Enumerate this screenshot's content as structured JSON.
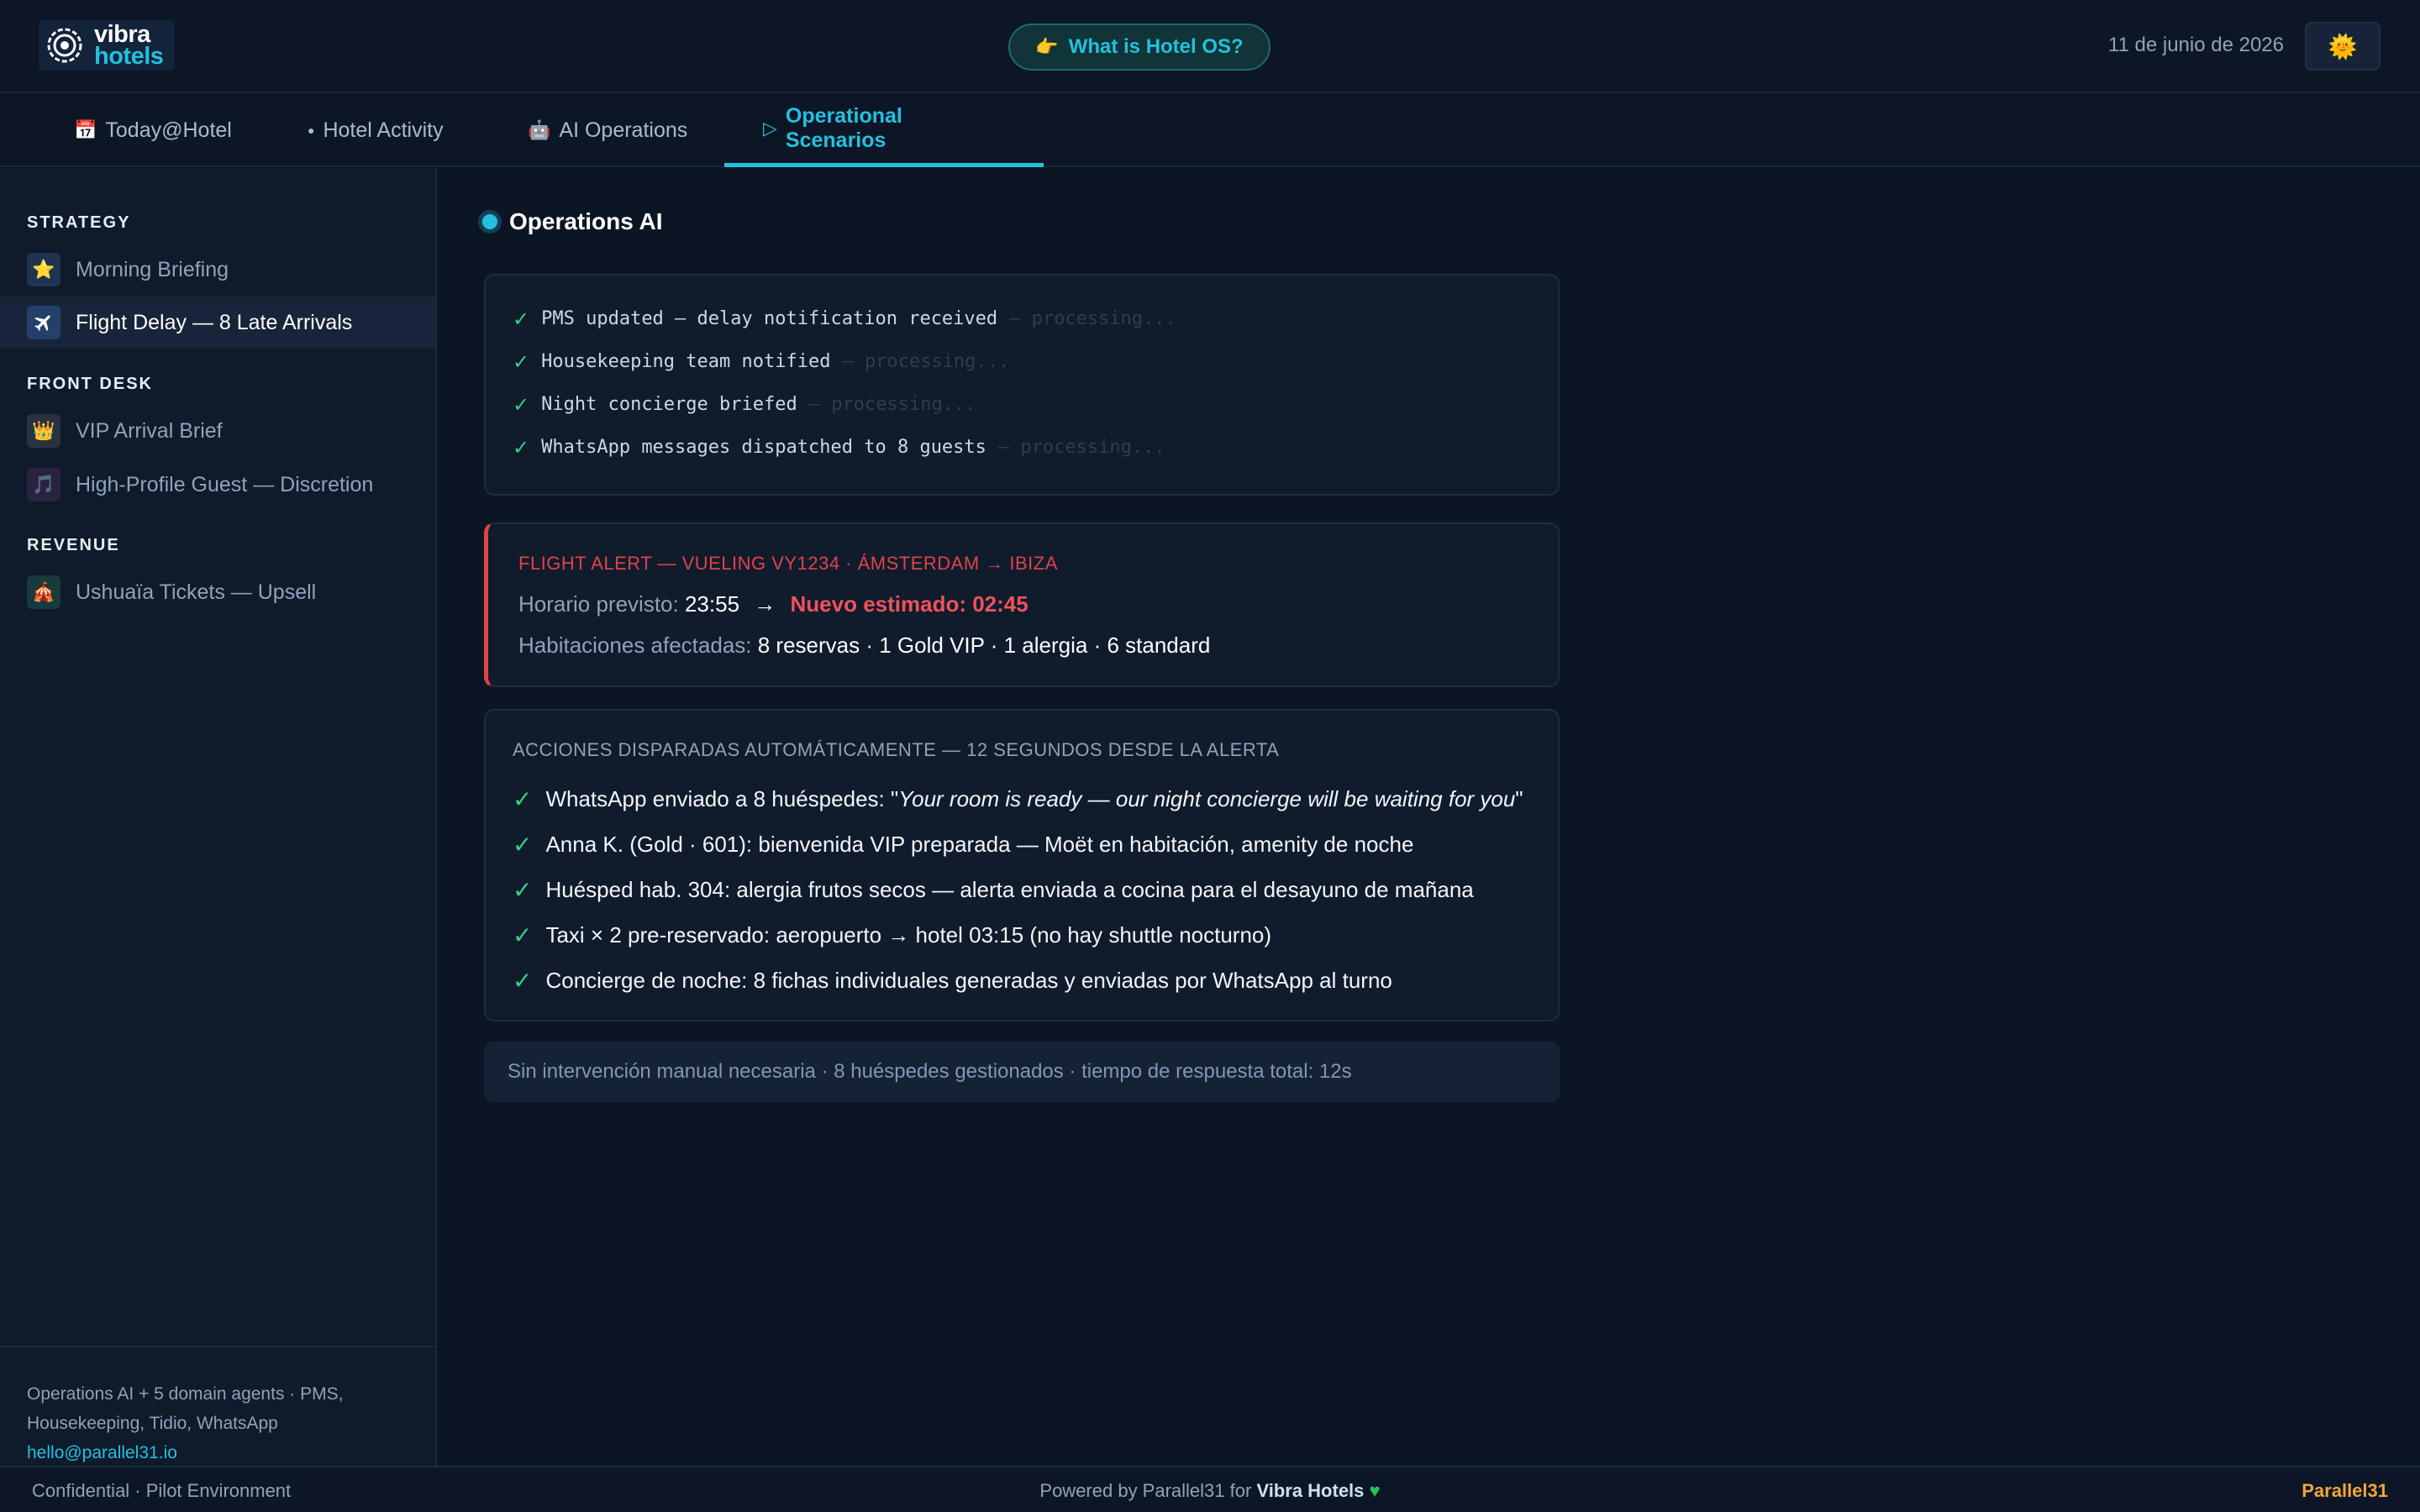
{
  "header": {
    "logo_line1": "vibra",
    "logo_line2": "hotels",
    "whatis_label": "What is Hotel OS?",
    "whatis_icon": "pointing-hand-icon",
    "date": "11 de junio de 2026",
    "theme_icon": "sun-icon"
  },
  "tabs": [
    {
      "label": "Today@Hotel",
      "icon": "calendar-icon"
    },
    {
      "label": "Hotel Activity",
      "icon": "dot-icon"
    },
    {
      "label": "AI Operations",
      "icon": "robot-icon"
    },
    {
      "label": "Operational Scenarios",
      "icon": "play-icon"
    }
  ],
  "active_tab": "Operational Scenarios",
  "sidebar": {
    "sections": [
      {
        "title": "STRATEGY",
        "items": [
          {
            "label": "Morning Briefing",
            "icon": "star-icon"
          },
          {
            "label": "Flight Delay — 8 Late Arrivals",
            "icon": "airplane-icon"
          }
        ]
      },
      {
        "title": "FRONT DESK",
        "items": [
          {
            "label": "VIP Arrival Brief",
            "icon": "crown-icon"
          },
          {
            "label": "High-Profile Guest — Discretion",
            "icon": "music-note-icon"
          }
        ]
      },
      {
        "title": "REVENUE",
        "items": [
          {
            "label": "Ushuaïa Tickets — Upsell",
            "icon": "tent-icon"
          }
        ]
      }
    ],
    "active_item": "Flight Delay — 8 Late Arrivals",
    "footer_text": "Operations AI + 5 domain agents · PMS, Housekeeping, Tidio, WhatsApp",
    "footer_email": "hello@parallel31.io"
  },
  "panel": {
    "title": "Operations AI",
    "log": [
      {
        "text": "PMS updated — delay notification received",
        "status": "— processing..."
      },
      {
        "text": "Housekeeping team notified",
        "status": "— processing..."
      },
      {
        "text": "Night concierge briefed",
        "status": "— processing..."
      },
      {
        "text": "WhatsApp messages dispatched to 8 guests",
        "status": "— processing..."
      }
    ],
    "alert": {
      "heading": "FLIGHT ALERT — VUELING VY1234 · ÁMSTERDAM → IBIZA",
      "scheduled_label": "Horario previsto:",
      "scheduled_value": "23:55",
      "arrow": "→",
      "new_estimate": "Nuevo estimado: 02:45",
      "rooms_label": "Habitaciones afectadas:",
      "rooms_value": "8 reservas · 1 Gold VIP · 1 alergia · 6 standard"
    },
    "actions": {
      "heading": "ACCIONES DISPARADAS AUTOMÁTICAMENTE — 12 SEGUNDOS DESDE LA ALERTA",
      "items": [
        {
          "prefix": "WhatsApp enviado a 8 huéspedes: \"",
          "quote": "Your room is ready — our night concierge will be waiting for you",
          "suffix": "\""
        },
        {
          "prefix": "Anna K. (Gold · 601): bienvenida VIP preparada — Moët en habitación, amenity de noche",
          "quote": "",
          "suffix": ""
        },
        {
          "prefix": "Huésped hab. 304: alergia frutos secos — alerta enviada a cocina para el desayuno de mañana",
          "quote": "",
          "suffix": ""
        },
        {
          "prefix": "Taxi × 2 pre-reservado: aeropuerto → hotel 03:15 (no hay shuttle nocturno)",
          "quote": "",
          "suffix": ""
        },
        {
          "prefix": "Concierge de noche: 8 fichas individuales generadas y enviadas por WhatsApp al turno",
          "quote": "",
          "suffix": ""
        }
      ]
    },
    "summary": "Sin intervención manual necesaria · 8 huéspedes gestionados · tiempo de respuesta total: 12s"
  },
  "footer": {
    "left": "Confidential · Pilot Environment",
    "center_prefix": "Powered by Parallel31 for",
    "center_brand": "Vibra Hotels",
    "right": "Parallel31"
  },
  "colors": {
    "background": "#0c1524",
    "accent": "#23c1de",
    "alert": "#e0434a",
    "success": "#35d07f",
    "brand_orange": "#f0a53a"
  }
}
